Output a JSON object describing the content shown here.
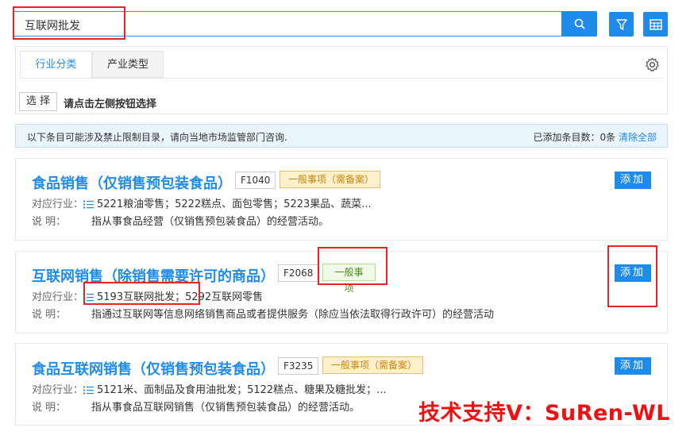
{
  "search": {
    "value": "互联网批发"
  },
  "tabs": [
    {
      "label": "行业分类"
    },
    {
      "label": "产业类型"
    }
  ],
  "selector": {
    "button": "选 择",
    "hint": "请点击左侧按钮选择"
  },
  "notice": {
    "text": "以下条目可能涉及禁止限制目录，请向当地市场监管部门咨询.",
    "count_text": "已添加条目数：0条",
    "clear_label": "清除全部"
  },
  "cards": [
    {
      "title": "食品销售（仅销售预包装食品）",
      "code": "F1040",
      "badge": "一般事项（需备案）",
      "industry_label": "对应行业：",
      "industry": "5221粮油零售；5222糕点、面包零售；5223果品、蔬菜...",
      "desc_label": "说        明：",
      "desc": "指从事食品经营（仅销售预包装食品）的经营活动。",
      "add_label": "添加"
    },
    {
      "title": "互联网销售（除销售需要许可的商品）",
      "code": "F2068",
      "badge": "一般事项",
      "industry_label": "对应行业：",
      "industry": "5193互联网批发；5292互联网零售",
      "desc_label": "说        明：",
      "desc": "指通过互联网等信息网络销售商品或者提供服务（除应当依法取得行政许可）的经营活动",
      "add_label": "添加"
    },
    {
      "title": "食品互联网销售（仅销售预包装食品）",
      "code": "F3235",
      "badge": "一般事项（需备案）",
      "industry_label": "对应行业：",
      "industry": "5121米、面制品及食用油批发；5122糕点、糖果及糖批发；...",
      "desc_label": "说        明：",
      "desc": "指从事食品互联网销售（仅销售预包装食品）的经营活动。",
      "add_label": "添加"
    }
  ],
  "watermark": "技术支持V：SuRen-WL",
  "colors": {
    "accent": "#1f8ceb",
    "annotation": "#ee2222"
  }
}
